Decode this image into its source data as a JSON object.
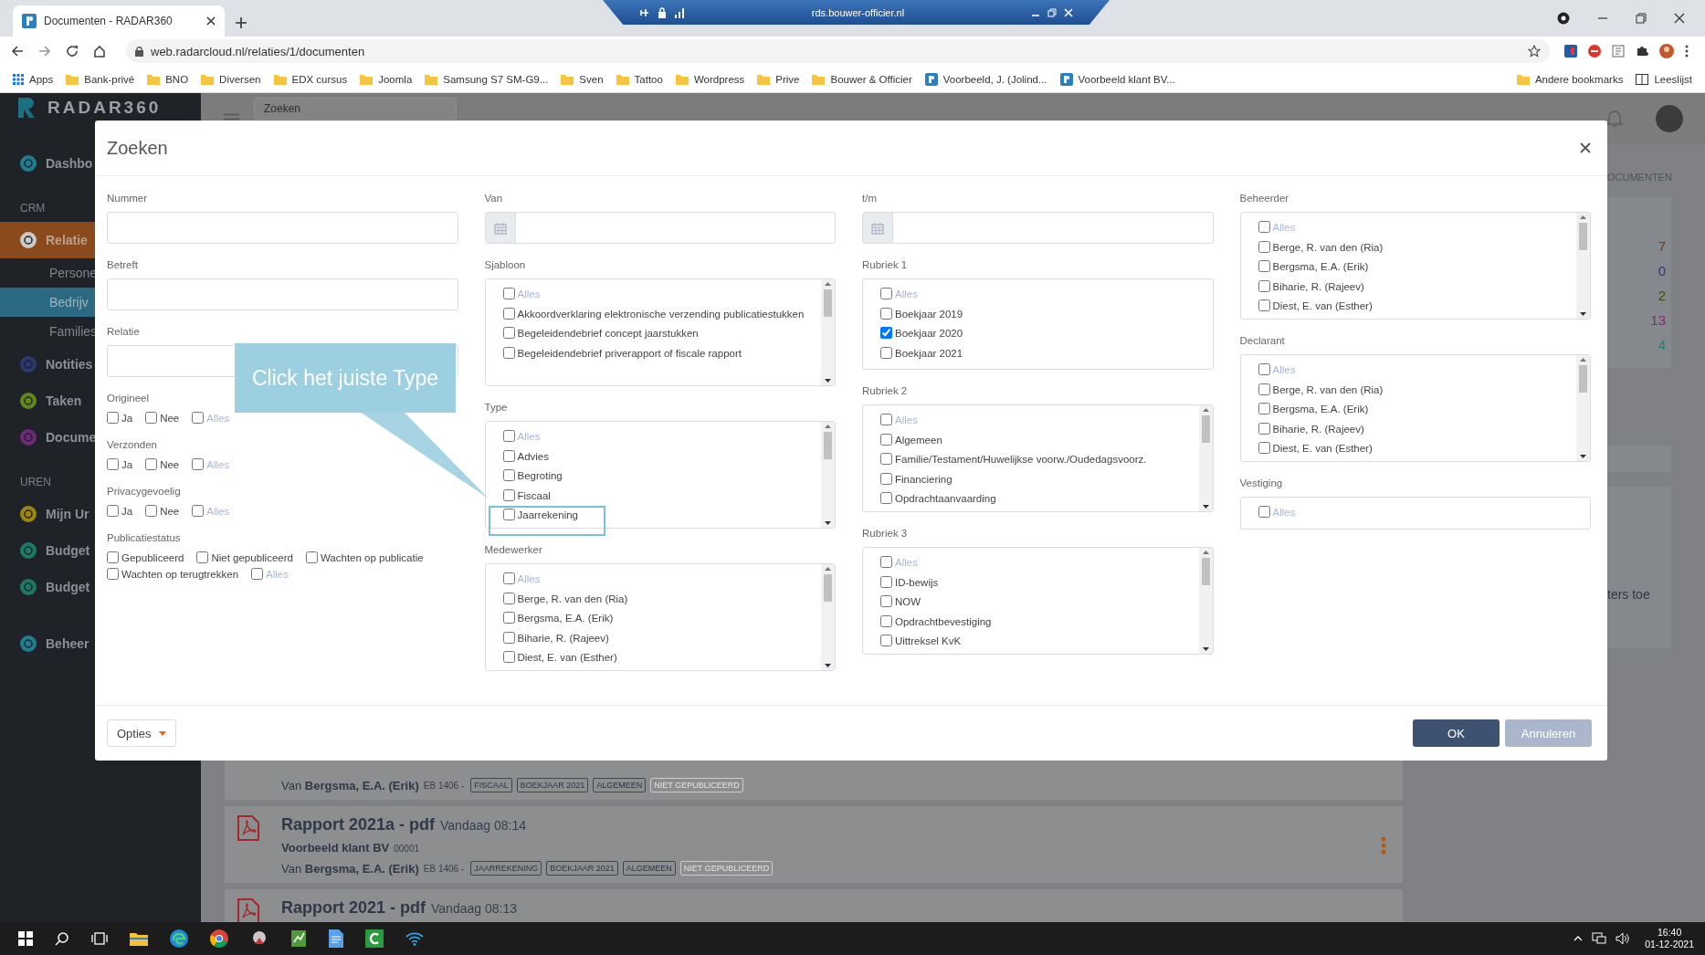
{
  "browser": {
    "tab_title": "Documenten - RADAR360",
    "remote_host": "rds.bouwer-officier.nl",
    "url": "web.radarcloud.nl/relaties/1/documenten",
    "bookmarks": [
      {
        "kind": "apps",
        "label": "Apps"
      },
      {
        "kind": "folder",
        "label": "Bank-privé"
      },
      {
        "kind": "folder",
        "label": "BNO"
      },
      {
        "kind": "folder",
        "label": "Diversen"
      },
      {
        "kind": "folder",
        "label": "EDX cursus"
      },
      {
        "kind": "folder",
        "label": "Joomla"
      },
      {
        "kind": "folder",
        "label": "Samsung S7 SM-G9..."
      },
      {
        "kind": "folder",
        "label": "Sven"
      },
      {
        "kind": "folder",
        "label": "Tattoo"
      },
      {
        "kind": "folder",
        "label": "Wordpress"
      },
      {
        "kind": "folder",
        "label": "Prive"
      },
      {
        "kind": "folder",
        "label": "Bouwer & Officier"
      },
      {
        "kind": "site",
        "label": "Voorbeeld, J. (Jolind..."
      },
      {
        "kind": "site",
        "label": "Voorbeeld klant BV..."
      }
    ],
    "bookmarks_right": [
      {
        "kind": "folder",
        "label": "Andere bookmarks"
      },
      {
        "kind": "list",
        "label": "Leeslijst"
      }
    ]
  },
  "app": {
    "logo": "RADAR360",
    "sidebar": [
      {
        "kind": "item",
        "label": "Dashbo",
        "color": "#1f7d92",
        "selected": false
      },
      {
        "kind": "section",
        "label": "CRM"
      },
      {
        "kind": "item",
        "label": "Relatie",
        "color": "#c9c9c9",
        "selected": true
      },
      {
        "kind": "sub",
        "label": "Persone",
        "selected": false
      },
      {
        "kind": "sub",
        "label": "Bedrijv",
        "selected": true
      },
      {
        "kind": "sub",
        "label": "Families",
        "selected": false
      },
      {
        "kind": "item",
        "label": "Notities",
        "color": "#2a3a6e",
        "selected": false
      },
      {
        "kind": "item",
        "label": "Taken",
        "color": "#5f8a1a",
        "selected": false
      },
      {
        "kind": "item",
        "label": "Docume",
        "color": "#6d2a78",
        "selected": false
      },
      {
        "kind": "section",
        "label": "UREN"
      },
      {
        "kind": "item",
        "label": "Mijn Ur",
        "color": "#9c8410",
        "selected": false
      },
      {
        "kind": "item",
        "label": "Budget",
        "color": "#1b7a66",
        "selected": false
      },
      {
        "kind": "item",
        "label": "Budget",
        "color": "#1b7a66",
        "selected": false
      },
      {
        "kind": "item",
        "label": "Beheer",
        "color": "#1f7d92",
        "selected": false
      }
    ],
    "search": {
      "placeholder": "Zoeken"
    },
    "side_panel": {
      "tab": "OCUMENTEN",
      "counts": [
        {
          "value": "7",
          "color": "#7a3604"
        },
        {
          "value": "0",
          "color": "#2c3c70"
        },
        {
          "value": "2",
          "color": "#3a5004"
        },
        {
          "value": "13",
          "color": "#84287e"
        },
        {
          "value": "4",
          "color": "#17826f"
        }
      ],
      "note": "ters toe"
    },
    "documents": [
      {
        "author": "Van **Bergsma, E.A. (Erik)**",
        "code": "EB 1406 -",
        "tags": [
          {
            "label": "FISCAAL",
            "muted": false
          },
          {
            "label": "BOEKJAAR 2021",
            "muted": false
          },
          {
            "label": "ALGEMEEN",
            "muted": false
          },
          {
            "label": "NIET GEPUBLICEERD",
            "muted": true
          }
        ]
      },
      {
        "title": "Rapport 2021a - pdf",
        "time": "Vandaag 08:14",
        "client": "Voorbeeld klant BV",
        "client_no": "00001",
        "author": "Van **Bergsma, E.A. (Erik)**",
        "code": "EB 1406 -",
        "tags": [
          {
            "label": "JAARREKENING",
            "muted": false
          },
          {
            "label": "BOEKJAAR 2021",
            "muted": false
          },
          {
            "label": "ALGEMEEN",
            "muted": false
          },
          {
            "label": "NIET GEPUBLICEERD",
            "muted": true
          }
        ]
      },
      {
        "title": "Rapport 2021 - pdf",
        "time": "Vandaag 08:13"
      }
    ]
  },
  "modal": {
    "title": "Zoeken",
    "columns": [
      [
        {
          "kind": "text",
          "label": "Nummer"
        },
        {
          "kind": "text",
          "label": "Betreft"
        },
        {
          "kind": "text",
          "label": "Relatie"
        },
        {
          "kind": "checkgroup",
          "label": "Origineel",
          "options": [
            {
              "kind": "option",
              "label": "Ja",
              "checked": false
            },
            {
              "kind": "option",
              "label": "Nee",
              "checked": false
            },
            {
              "kind": "all",
              "label": "Alles",
              "checked": false
            }
          ]
        },
        {
          "kind": "checkgroup",
          "label": "Verzonden",
          "options": [
            {
              "kind": "option",
              "label": "Ja",
              "checked": false
            },
            {
              "kind": "option",
              "label": "Nee",
              "checked": false
            },
            {
              "kind": "all",
              "label": "Alles",
              "checked": false
            }
          ]
        },
        {
          "kind": "checkgroup",
          "label": "Privacygevoelig",
          "options": [
            {
              "kind": "option",
              "label": "Ja",
              "checked": false
            },
            {
              "kind": "option",
              "label": "Nee",
              "checked": false
            },
            {
              "kind": "all",
              "label": "Alles",
              "checked": false
            }
          ]
        },
        {
          "kind": "checkgroup",
          "label": "Publicatiestatus",
          "options": [
            {
              "kind": "option",
              "label": "Gepubliceerd",
              "checked": false
            },
            {
              "kind": "option",
              "label": "Niet gepubliceerd",
              "checked": false
            },
            {
              "kind": "option",
              "label": "Wachten op publicatie",
              "checked": false
            },
            {
              "kind": "option",
              "label": "Wachten op terugtrekken",
              "checked": false
            },
            {
              "kind": "all",
              "label": "Alles",
              "checked": false
            }
          ]
        }
      ],
      [
        {
          "kind": "date",
          "label": "Van"
        },
        {
          "kind": "checklist",
          "label": "Sjabloon",
          "scrollable": true,
          "items": [
            {
              "kind": "all",
              "label": "Alles",
              "checked": false
            },
            {
              "kind": "option",
              "label": "Akkoordverklaring elektronische verzending publicatiestukken",
              "checked": false
            },
            {
              "kind": "option",
              "label": "Begeleidendebrief concept jaarstukken",
              "checked": false
            },
            {
              "kind": "option",
              "label": "Begeleidendebrief priverapport of fiscale rapport",
              "checked": false
            }
          ]
        },
        {
          "kind": "checklist",
          "label": "Type",
          "scrollable": true,
          "items": [
            {
              "kind": "all",
              "label": "Alles",
              "checked": false
            },
            {
              "kind": "option",
              "label": "Advies",
              "checked": false
            },
            {
              "kind": "option",
              "label": "Begroting",
              "checked": false
            },
            {
              "kind": "option",
              "label": "Fiscaal",
              "checked": false
            },
            {
              "kind": "option",
              "label": "Jaarrekening",
              "checked": false
            }
          ]
        },
        {
          "kind": "checklist",
          "label": "Medewerker",
          "scrollable": true,
          "items": [
            {
              "kind": "all",
              "label": "Alles",
              "checked": false
            },
            {
              "kind": "option",
              "label": "Berge, R. van den (Ria)",
              "checked": false
            },
            {
              "kind": "option",
              "label": "Bergsma, E.A. (Erik)",
              "checked": false
            },
            {
              "kind": "option",
              "label": "Biharie, R. (Rajeev)",
              "checked": false
            },
            {
              "kind": "option",
              "label": "Diest, E. van (Esther)",
              "checked": false
            }
          ]
        }
      ],
      [
        {
          "kind": "date",
          "label": "t/m"
        },
        {
          "kind": "checklist",
          "label": "Rubriek 1",
          "scrollable": false,
          "items": [
            {
              "kind": "all",
              "label": "Alles",
              "checked": false
            },
            {
              "kind": "option",
              "label": "Boekjaar 2019",
              "checked": false
            },
            {
              "kind": "option",
              "label": "Boekjaar 2020",
              "checked": true
            },
            {
              "kind": "option",
              "label": "Boekjaar 2021",
              "checked": false
            }
          ]
        },
        {
          "kind": "checklist",
          "label": "Rubriek 2",
          "scrollable": true,
          "items": [
            {
              "kind": "all",
              "label": "Alles",
              "checked": false
            },
            {
              "kind": "option",
              "label": "Algemeen",
              "checked": false
            },
            {
              "kind": "option",
              "label": "Familie/Testament/Huwelijkse voorw./Oudedagsvoorz.",
              "checked": false
            },
            {
              "kind": "option",
              "label": "Financiering",
              "checked": false
            },
            {
              "kind": "option",
              "label": "Opdrachtaanvaarding",
              "checked": false
            }
          ]
        },
        {
          "kind": "checklist",
          "label": "Rubriek 3",
          "scrollable": true,
          "items": [
            {
              "kind": "all",
              "label": "Alles",
              "checked": false
            },
            {
              "kind": "option",
              "label": "ID-bewijs",
              "checked": false
            },
            {
              "kind": "option",
              "label": "NOW",
              "checked": false
            },
            {
              "kind": "option",
              "label": "Opdrachtbevestiging",
              "checked": false
            },
            {
              "kind": "option",
              "label": "Uittreksel KvK",
              "checked": false
            }
          ]
        }
      ],
      [
        {
          "kind": "checklist",
          "label": "Beheerder",
          "scrollable": true,
          "items": [
            {
              "kind": "all",
              "label": "Alles",
              "checked": false
            },
            {
              "kind": "option",
              "label": "Berge, R. van den (Ria)",
              "checked": false
            },
            {
              "kind": "option",
              "label": "Bergsma, E.A. (Erik)",
              "checked": false
            },
            {
              "kind": "option",
              "label": "Biharie, R. (Rajeev)",
              "checked": false
            },
            {
              "kind": "option",
              "label": "Diest, E. van (Esther)",
              "checked": false
            }
          ]
        },
        {
          "kind": "checklist",
          "label": "Declarant",
          "scrollable": true,
          "items": [
            {
              "kind": "all",
              "label": "Alles",
              "checked": false
            },
            {
              "kind": "option",
              "label": "Berge, R. van den (Ria)",
              "checked": false
            },
            {
              "kind": "option",
              "label": "Bergsma, E.A. (Erik)",
              "checked": false
            },
            {
              "kind": "option",
              "label": "Biharie, R. (Rajeev)",
              "checked": false
            },
            {
              "kind": "option",
              "label": "Diest, E. van (Esther)",
              "checked": false
            }
          ]
        },
        {
          "kind": "checklist",
          "label": "Vestiging",
          "scrollable": false,
          "items": [
            {
              "kind": "all",
              "label": "Alles",
              "checked": false
            }
          ]
        }
      ]
    ],
    "options_button": "Opties",
    "ok_button": "OK",
    "cancel_button": "Annuleren"
  },
  "callout": {
    "text": "Click het juiste Type"
  },
  "taskbar": {
    "time": "16:40",
    "date": "01-12-2021"
  }
}
